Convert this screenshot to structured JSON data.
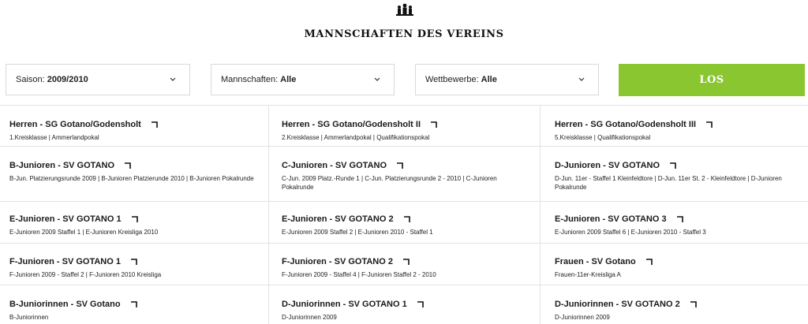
{
  "header": {
    "icon": "team-icon",
    "title": "MANNSCHAFTEN DES VEREINS"
  },
  "filters": {
    "season": {
      "label": "Saison:",
      "value": "2009/2010"
    },
    "teams": {
      "label": "Mannschaften:",
      "value": "Alle"
    },
    "competitions": {
      "label": "Wettbewerbe:",
      "value": "Alle"
    },
    "submit_label": "LOS",
    "accent_color": "#8ac630"
  },
  "teams": [
    {
      "name": "Herren - SG Gotano/Godensholt",
      "competitions": "1.Kreisklasse | Ammerlandpokal"
    },
    {
      "name": "Herren - SG Gotano/Godensholt II",
      "competitions": "2.Kreisklasse | Ammerlandpokal | Qualifikationspokal"
    },
    {
      "name": "Herren - SG Gotano/Godensholt III",
      "competitions": "5.Kreisklasse | Qualifikationspokal"
    },
    {
      "name": "B-Junioren - SV GOTANO",
      "competitions": "B-Jun. Platzierungsrunde 2009 | B-Junioren Platzierunde 2010 | B-Junioren Pokalrunde"
    },
    {
      "name": "C-Junioren - SV GOTANO",
      "competitions": "C-Jun. 2009 Platz.-Runde 1 | C-Jun. Platzierungsrunde 2 - 2010 | C-Junioren Pokalrunde"
    },
    {
      "name": "D-Junioren - SV GOTANO",
      "competitions": "D-Jun. 11er - Staffel 1 Kleinfeldtore | D-Jun. 11er St. 2 - Kleinfeldtore | D-Junioren Pokalrunde"
    },
    {
      "name": "E-Junioren - SV GOTANO 1",
      "competitions": "E-Junioren 2009 Staffel 1 | E-Junioren Kreisliga 2010"
    },
    {
      "name": "E-Junioren - SV GOTANO 2",
      "competitions": "E-Junioren 2009 Staffel 2 | E-Junioren 2010 - Staffel 1"
    },
    {
      "name": "E-Junioren - SV GOTANO 3",
      "competitions": "E-Junioren 2009 Staffel 6 | E-Junioren 2010 - Staffel 3"
    },
    {
      "name": "F-Junioren - SV GOTANO 1",
      "competitions": "F-Junioren 2009 - Staffel 2 | F-Junioren 2010 Kreisliga"
    },
    {
      "name": "F-Junioren - SV GOTANO 2",
      "competitions": "F-Junioren 2009 - Staffel 4 | F-Junioren Staffel 2 - 2010"
    },
    {
      "name": "Frauen - SV Gotano",
      "competitions": "Frauen-11er-Kreisliga A"
    },
    {
      "name": "B-Juniorinnen - SV Gotano",
      "competitions": "B-Juniorinnen"
    },
    {
      "name": "D-Juniorinnen - SV GOTANO 1",
      "competitions": "D-Juniorinnen 2009"
    },
    {
      "name": "D-Juniorinnen - SV GOTANO 2",
      "competitions": "D-Juniorinnen 2009"
    }
  ]
}
